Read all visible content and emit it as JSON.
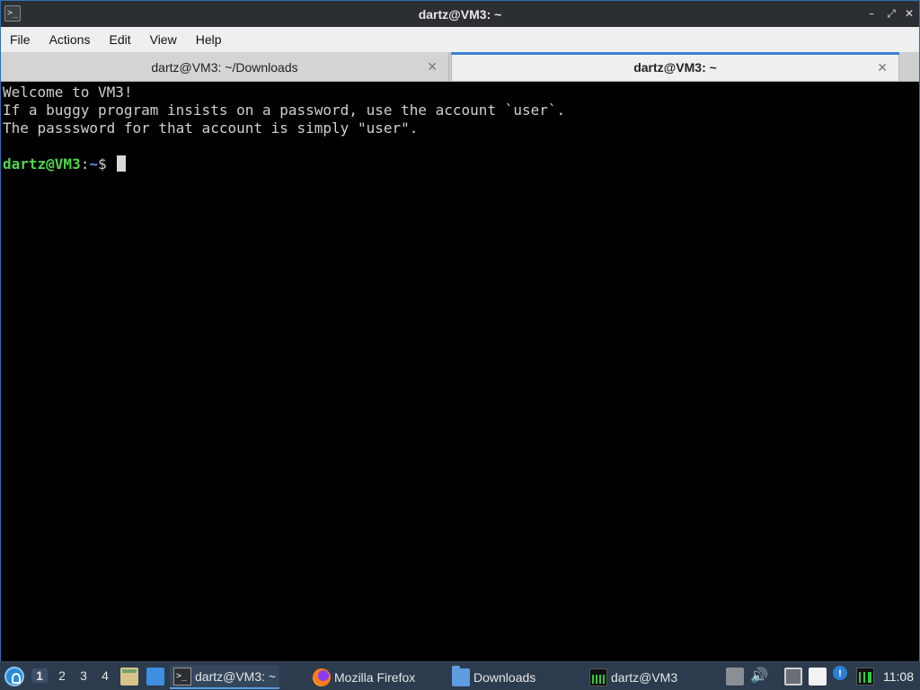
{
  "window": {
    "title": "dartz@VM3: ~",
    "app_icon": ">_",
    "minimize_glyph": "–",
    "maximize_glyph": "⤢",
    "close_glyph": "✕"
  },
  "menubar": {
    "items": [
      "File",
      "Actions",
      "Edit",
      "View",
      "Help"
    ]
  },
  "tabs": [
    {
      "label": "dartz@VM3: ~/Downloads",
      "active": false
    },
    {
      "label": "dartz@VM3: ~",
      "active": true
    }
  ],
  "tab_close_glyph": "✕",
  "terminal": {
    "lines": [
      "Welcome to VM3!",
      "If a buggy program insists on a password, use the account `user`.",
      "The passsword for that account is simply \"user\"."
    ],
    "prompt_user": "dartz@VM3",
    "prompt_sep": ":",
    "prompt_path": "~",
    "prompt_symbol": "$ "
  },
  "taskbar": {
    "workspaces": [
      "1",
      "2",
      "3",
      "4"
    ],
    "active_workspace": "1",
    "tasks": [
      {
        "label": "dartz@VM3: ~",
        "icon": "terminal-icon",
        "active": true
      },
      {
        "label": "Mozilla Firefox",
        "icon": "firefox-icon",
        "active": false
      },
      {
        "label": "Downloads",
        "icon": "folder-icon",
        "active": false
      },
      {
        "label": "dartz@VM3",
        "icon": "system-monitor-icon",
        "active": false
      }
    ],
    "volume_glyph": "🔊",
    "info_glyph": "!",
    "clock": "11:08"
  },
  "colors": {
    "prompt_user": "#4fd64a",
    "prompt_path": "#6b8df2",
    "active_tab_accent": "#3b82d1",
    "taskbar_bg": "#2c3b4d"
  }
}
